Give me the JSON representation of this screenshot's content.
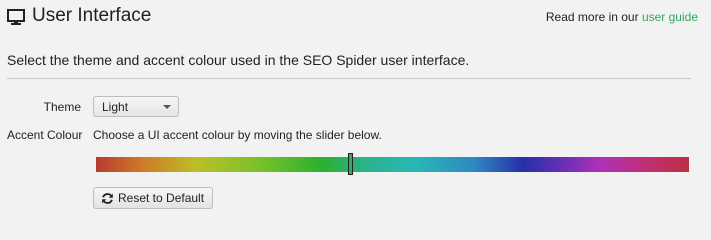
{
  "header": {
    "icon": "monitor-icon",
    "title": "User Interface",
    "read_more_prefix": "Read more in our",
    "read_more_link": "user guide"
  },
  "description": "Select the theme and accent colour used in the SEO Spider user interface.",
  "theme": {
    "label": "Theme",
    "selected": "Light"
  },
  "accent": {
    "label": "Accent Colour",
    "hint": "Choose a UI accent colour by moving the slider below.",
    "slider_value": 0.43,
    "thumb_color": "#3aa36b"
  },
  "reset": {
    "icon": "refresh-icon",
    "label": "Reset to Default"
  },
  "colors": {
    "link": "#2eaa5c"
  }
}
